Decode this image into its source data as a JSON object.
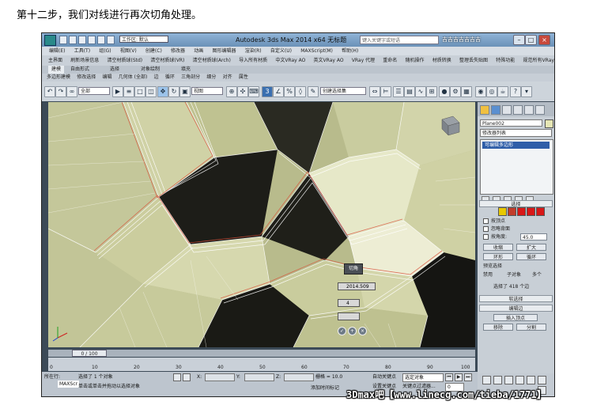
{
  "caption": "第十二步，我们对线进行再次切角处理。",
  "titlebar": {
    "workspace": "工作区: 默认",
    "app_title": "Autodesk 3ds Max  2014 x64     无标题",
    "search_placeholder": "键入关键字或短语",
    "brand_text": "吉吉吉吉吉吉吉"
  },
  "menubar": {
    "items": [
      "编辑(E)",
      "工具(T)",
      "组(G)",
      "视图(V)",
      "创建(C)",
      "修改器",
      "动画",
      "图形编辑器",
      "渲染(R)",
      "自定义(U)",
      "MAXScript(M)",
      "帮助(H)"
    ]
  },
  "toolbar1": {
    "items": [
      "主界面",
      "刷新场景信息",
      "清空材质球(Std)",
      "清空材质球(VR)",
      "清空材质球(Arch)",
      "导入所有材质",
      "中文VRay AO",
      "英文VRay AO",
      "VRay 代理",
      "重命名",
      "随机操作",
      "材质转换",
      "整理丢失贴图",
      "特殊功能",
      "规范所有VRay材"
    ]
  },
  "ribbon": {
    "tabs": [
      "建模",
      "自由形式",
      "选择",
      "对象绘制",
      "填充"
    ],
    "sub_items": [
      "多边形建模",
      "修改选择",
      "编辑",
      "几何体 (全部)",
      "边",
      "循环",
      "三角剖分",
      "细分",
      "对齐",
      "属性"
    ]
  },
  "main_toolbar": {
    "selection_filter": "全部",
    "reference_coord": "视图",
    "named_selection": "创建选择集"
  },
  "viewport": {
    "caddy": {
      "label": "切角",
      "amount": "2014.509",
      "segments": "4"
    }
  },
  "command_panel": {
    "object_name": "Plane002",
    "modifier_list": "修改器列表",
    "stack_item": "可编辑多边形",
    "selection_rollout": "选择",
    "by_vertex": "按顶点",
    "ignore_backfacing": "忽略背面",
    "by_angle": "按角度:",
    "angle_value": "45.0",
    "shrink": "收缩",
    "grow": "扩大",
    "ring": "环形",
    "loop": "循环",
    "preview_selection": "预览选择",
    "preview_options": [
      "禁用",
      "子对象",
      "多个"
    ],
    "selected_count": "选择了 418 个边",
    "soft_selection": "软选择",
    "edit_edges": "编辑边",
    "insert_vertex": "插入顶点",
    "remove": "移除",
    "split": "分割",
    "sub_object_colors": [
      "#e8c800",
      "#c23c2a",
      "#d81818",
      "#d81818",
      "#d81818"
    ]
  },
  "timeline": {
    "slider": "0 / 100",
    "ticks": [
      "0",
      "10",
      "20",
      "30",
      "40",
      "50",
      "60",
      "70",
      "80",
      "90",
      "100"
    ]
  },
  "statusbar": {
    "left_label": "所在行:",
    "maxscript": "MAXScr",
    "selection_text": "选择了 1 个对象",
    "prompt_text": "单击或单击并拖动以选择对象",
    "x_label": "X:",
    "y_label": "Y:",
    "z_label": "Z:",
    "grid_text": "栅格 = 10.0",
    "auto_key": "自动关键点",
    "set_key": "设置关键点",
    "key_filter": "选定对象",
    "key_filter_btn": "关键点过滤器...",
    "add_time_tag": "添加时间标记",
    "frame_value": "0"
  },
  "watermark": "3Dmax吧【www.linecg.com/tieba/1771】"
}
